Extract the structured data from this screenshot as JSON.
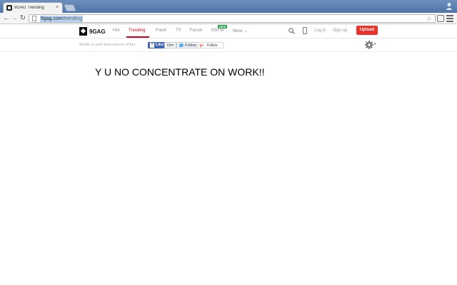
{
  "browser": {
    "tab_title": "9GAG Trending",
    "tab_close": "×",
    "url_domain": "9gag.com",
    "url_path": "/trending",
    "back": "←",
    "forward": "→",
    "reload": "↻"
  },
  "site": {
    "logo_text": "9GAG",
    "nav": [
      {
        "label": "Hot"
      },
      {
        "label": "Trending"
      },
      {
        "label": "Fresh"
      },
      {
        "label": "TV"
      },
      {
        "label": "Forum"
      },
      {
        "label": "NSFW"
      },
      {
        "label": "More ⌄"
      }
    ],
    "active_nav": "Trending",
    "new_badge": "NEW",
    "login": "Log in",
    "signup": "Sign up",
    "upload": "Upload"
  },
  "subheader": {
    "tagline": "9GAG is your best source of fun.",
    "fb_like": "Like",
    "fb_count": "18m",
    "tw_follow": "Follow",
    "gp_icon": "g+",
    "gp_follow": "Follow",
    "gear_caret": "▾"
  },
  "content": {
    "headline": "Y U NO CONCENTRATE ON WORK!!"
  },
  "colors": {
    "accent": "#d0021b",
    "upload": "#e8322a",
    "facebook": "#4267b2",
    "twitter": "#55acee",
    "new_badge": "#1fa044"
  }
}
